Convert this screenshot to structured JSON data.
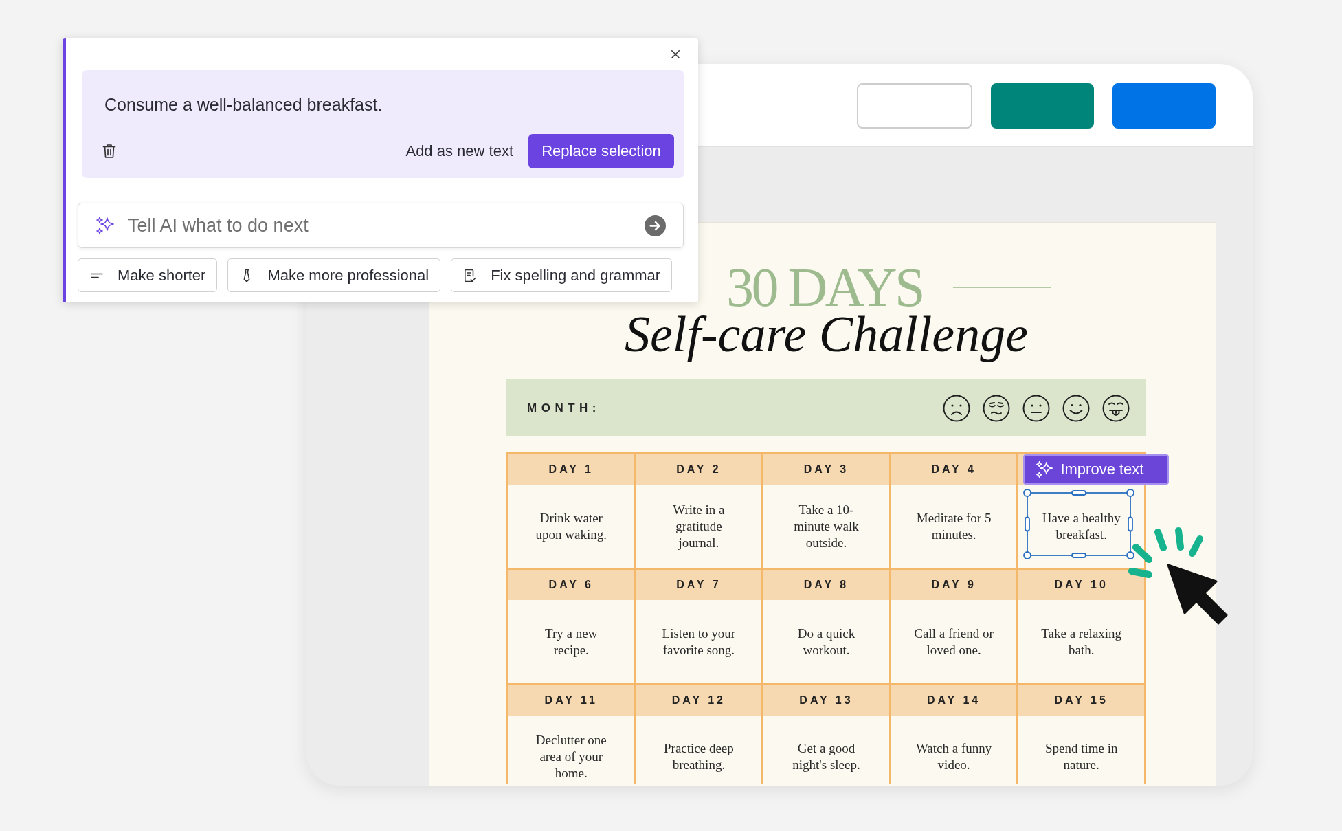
{
  "ai_panel": {
    "suggestion": "Consume a well-balanced breakfast.",
    "secondary_action": "Add as new text",
    "primary_action": "Replace selection",
    "prompt": {
      "placeholder": "Tell AI what to do next"
    },
    "quick_actions": [
      {
        "kind": "shorten",
        "label": "Make shorter"
      },
      {
        "kind": "professional",
        "label": "Make more professional"
      },
      {
        "kind": "grammar",
        "label": "Fix spelling and grammar"
      }
    ]
  },
  "toolbar": {
    "buttons": [
      {
        "kind": "outline"
      },
      {
        "kind": "filled",
        "color": "#00857a"
      },
      {
        "kind": "filled",
        "color": "#0073e6"
      }
    ]
  },
  "document": {
    "kicker": "30 DAYS",
    "title": "Self-care Challenge",
    "month_label": "MONTH:",
    "improve_button": "Improve text",
    "days": [
      {
        "label": "DAY 1",
        "task": "Drink water upon waking.",
        "selected": false
      },
      {
        "label": "DAY 2",
        "task": "Write in a gratitude journal.",
        "selected": false
      },
      {
        "label": "DAY 3",
        "task": "Take a 10-minute walk outside.",
        "selected": false
      },
      {
        "label": "DAY 4",
        "task": "Meditate for 5 minutes.",
        "selected": false
      },
      {
        "task": "Have a healthy breakfast.",
        "selected": true
      },
      {
        "label": "DAY 6",
        "task": "Try a new recipe.",
        "selected": false
      },
      {
        "label": "DAY 7",
        "task": "Listen to your favorite song.",
        "selected": false
      },
      {
        "label": "DAY 8",
        "task": "Do a quick workout.",
        "selected": false
      },
      {
        "label": "DAY 9",
        "task": "Call a friend or loved one.",
        "selected": false
      },
      {
        "label": "DAY 10",
        "task": "Take a relaxing bath.",
        "selected": false
      },
      {
        "label": "DAY 11",
        "task": "Declutter one area of your home.",
        "selected": false
      },
      {
        "label": "DAY 12",
        "task": "Practice deep breathing.",
        "selected": false
      },
      {
        "label": "DAY 13",
        "task": "Get a good night's sleep.",
        "selected": false
      },
      {
        "label": "DAY 14",
        "task": "Watch a funny video.",
        "selected": false
      },
      {
        "label": "DAY 15",
        "task": "Spend time in nature.",
        "selected": false
      }
    ]
  }
}
